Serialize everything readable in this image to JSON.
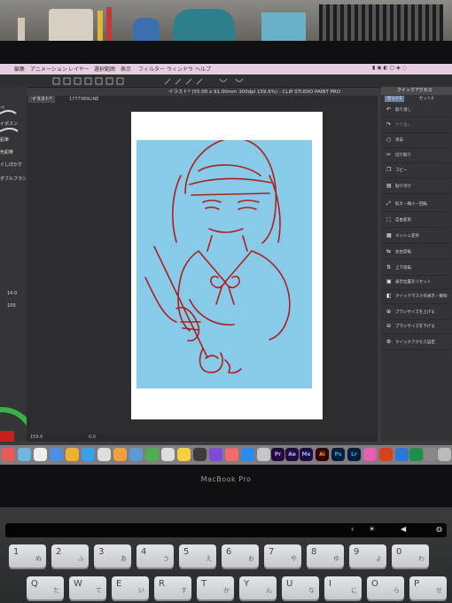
{
  "menubar": {
    "items": [
      "編集",
      "アニメーション",
      "レイヤー",
      "選択範囲",
      "表示",
      "フィルター",
      "ウィンドウ",
      "ヘルプ"
    ]
  },
  "document": {
    "title": "イラスト* (55.00 x 91.00mm 300dpi 159.6%) - CLIP STUDIO PAINT PRO",
    "tabs": [
      "イラスト*",
      "1777089LINE"
    ]
  },
  "left_panel": {
    "labels": [
      "ペ",
      "イポスン",
      "鉛筆",
      "色鉛筆",
      "ぐしぼかす",
      "ダブルブラシ"
    ],
    "size_values": [
      "14.0",
      "100"
    ]
  },
  "quick_access": {
    "title": "クイックアクセス",
    "tabs": [
      "セット1",
      "セット2"
    ],
    "items": [
      {
        "label": "取り消し",
        "icon": "undo-icon",
        "enabled": true
      },
      {
        "label": "やり直し",
        "icon": "redo-icon",
        "enabled": false
      },
      {
        "label": "消去",
        "icon": "clear-icon",
        "enabled": true
      },
      {
        "label": "切り取り",
        "icon": "cut-icon",
        "enabled": true
      },
      {
        "label": "コピー",
        "icon": "copy-icon",
        "enabled": true
      },
      {
        "label": "貼り付け",
        "icon": "paste-icon",
        "enabled": true
      },
      {
        "label": "拡大・縮小・回転",
        "icon": "scale-icon",
        "enabled": true
      },
      {
        "label": "自由変形",
        "icon": "free-transform-icon",
        "enabled": true
      },
      {
        "label": "メッシュ変形",
        "icon": "mesh-icon",
        "enabled": true
      },
      {
        "label": "左右反転",
        "icon": "flip-horizontal-icon",
        "enabled": true
      },
      {
        "label": "上下反転",
        "icon": "flip-vertical-icon",
        "enabled": true
      },
      {
        "label": "表示位置をリセット",
        "icon": "reset-view-icon",
        "enabled": true
      },
      {
        "label": "クイックマスクの表示・解除",
        "icon": "quick-mask-icon",
        "enabled": true
      },
      {
        "label": "ブラシサイズを上げる",
        "icon": "brush-up-icon",
        "enabled": true
      },
      {
        "label": "ブラシサイズを下げる",
        "icon": "brush-down-icon",
        "enabled": true
      },
      {
        "label": "クイックアクセス設定",
        "icon": "settings-icon",
        "enabled": true
      }
    ]
  },
  "statusbar": {
    "zoom": "159.6",
    "angle": "0.0"
  },
  "dock": {
    "apps": [
      "Pr",
      "Ae",
      "Me",
      "Ai",
      "Ps",
      "Lr"
    ]
  },
  "laptop": {
    "brand": "MacBook Pro"
  },
  "keyboard": {
    "row1": [
      "1",
      "2",
      "3",
      "4",
      "5",
      "6",
      "7",
      "8",
      "9",
      "0"
    ],
    "row2": [
      "Q",
      "W",
      "E",
      "R",
      "T",
      "Y",
      "U",
      "I",
      "O",
      "P"
    ],
    "kana1": [
      "ぬ",
      "ふ",
      "あ",
      "う",
      "え",
      "お",
      "や",
      "ゆ",
      "よ",
      "わ"
    ],
    "kana2": [
      "た",
      "て",
      "い",
      "す",
      "か",
      "ん",
      "な",
      "に",
      "ら",
      "せ"
    ]
  },
  "colors": {
    "canvas_bg": "#87cbe9",
    "line_art": "#b01e1e",
    "menubar": "#e7cfe2",
    "quick_access_tab": "#6b7fa6"
  }
}
